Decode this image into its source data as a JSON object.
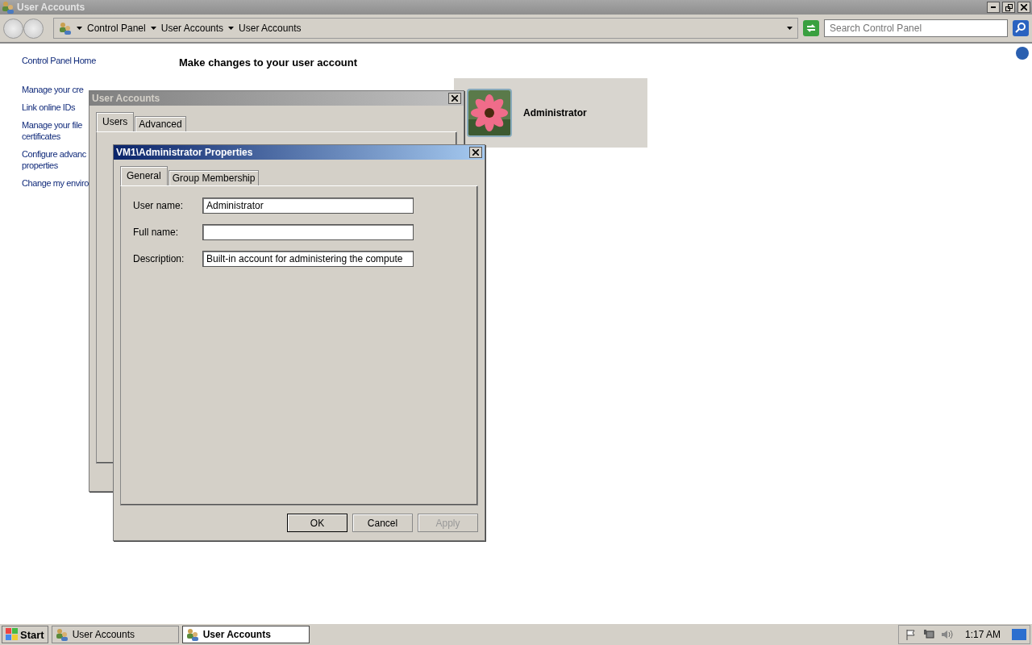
{
  "window": {
    "title": "User Accounts"
  },
  "address_bar": {
    "breadcrumbs": [
      "Control Panel",
      "User Accounts",
      "User Accounts"
    ]
  },
  "search": {
    "placeholder": "Search Control Panel"
  },
  "sidebar": {
    "items": [
      {
        "lines": [
          "Control Panel Home"
        ]
      },
      {
        "lines": [
          "Manage your cre"
        ]
      },
      {
        "lines": [
          "Link online IDs"
        ]
      },
      {
        "lines": [
          "Manage your file",
          "certificates"
        ]
      },
      {
        "lines": [
          "Configure advanc",
          "properties"
        ]
      },
      {
        "lines": [
          "Change my enviro"
        ]
      }
    ]
  },
  "main": {
    "heading": "Make changes to your user account",
    "account": {
      "name": "Administrator"
    }
  },
  "dialogs": [
    {
      "title": "User Accounts",
      "active": false,
      "tabs": [
        {
          "label": "Users",
          "selected": true
        },
        {
          "label": "Advanced",
          "selected": false
        }
      ]
    },
    {
      "title": "VM1\\Administrator Properties",
      "active": true,
      "tabs": [
        {
          "label": "General",
          "selected": true
        },
        {
          "label": "Group Membership",
          "selected": false
        }
      ],
      "fields": [
        {
          "label": "User name:",
          "value": "Administrator"
        },
        {
          "label": "Full name:"
        },
        {
          "label": "Description:",
          "value": "Built-in account for administering the compute"
        }
      ],
      "buttons": [
        {
          "label": "OK",
          "default": true,
          "disabled": false
        },
        {
          "label": "Cancel",
          "default": false,
          "disabled": false
        },
        {
          "label": "Apply",
          "default": false,
          "disabled": true
        }
      ]
    }
  ],
  "taskbar": {
    "start": "Start",
    "tasks": [
      {
        "label": "User Accounts",
        "selected": false
      },
      {
        "label": "User Accounts",
        "selected": true
      }
    ],
    "clock": "1:17 AM"
  }
}
